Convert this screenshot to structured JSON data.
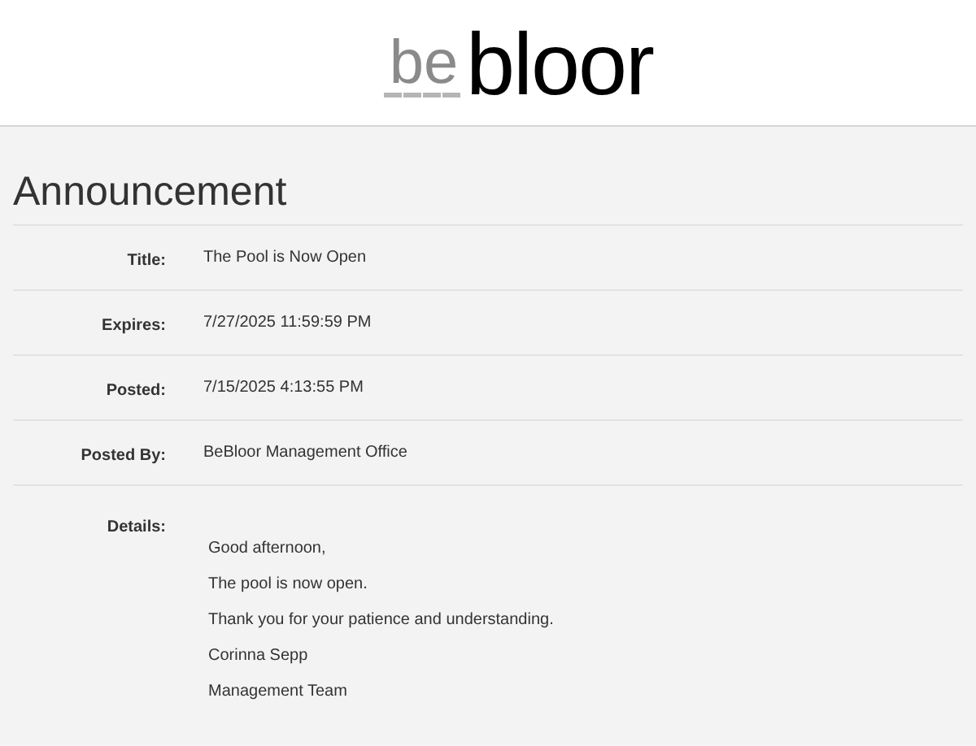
{
  "header": {
    "logo": {
      "prefix": "be",
      "name": "bloor"
    }
  },
  "page_title": "Announcement",
  "fields": [
    {
      "label": "Title:",
      "value": "The Pool is Now Open"
    },
    {
      "label": "Expires:",
      "value": "7/27/2025 11:59:59 PM"
    },
    {
      "label": "Posted:",
      "value": "7/15/2025 4:13:55 PM"
    },
    {
      "label": "Posted By:",
      "value": "BeBloor Management Office"
    }
  ],
  "details": {
    "label": "Details:",
    "lines": [
      "Good afternoon,",
      "The pool is now open.",
      "Thank you for your patience and understanding.",
      "Corinna Sepp",
      "Management Team"
    ]
  }
}
